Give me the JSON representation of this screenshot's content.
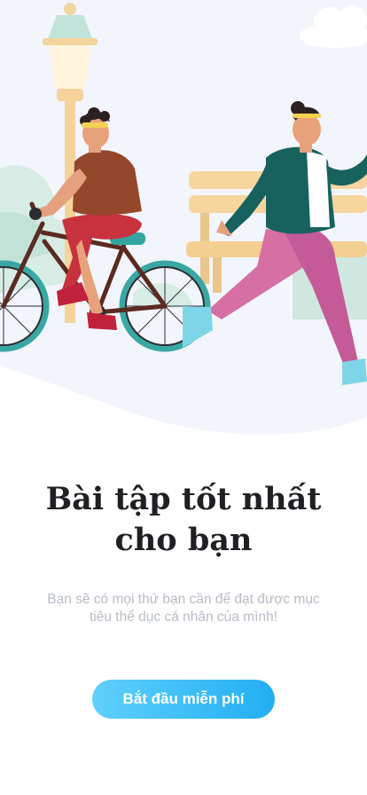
{
  "onboarding": {
    "title_line1": "Bài tập tốt nhất",
    "title_line2": "cho bạn",
    "subtitle_line1": "Bạn sẽ có mọi thứ bạn cần để đạt được mục",
    "subtitle_line2": "tiêu thể dục cá nhân của mình!",
    "cta_label": "Bắt đầu miễn phí"
  },
  "illustration": {
    "items": [
      "street-lamp",
      "cloud",
      "bench",
      "bushes",
      "cyclist",
      "runner"
    ]
  },
  "colors": {
    "background": "#ffffff",
    "hero_background": "#f3f5fc",
    "cta_start": "#5fd0fb",
    "cta_end": "#22aef3",
    "title": "#1f1f24",
    "subtitle": "#b7bcc6"
  }
}
